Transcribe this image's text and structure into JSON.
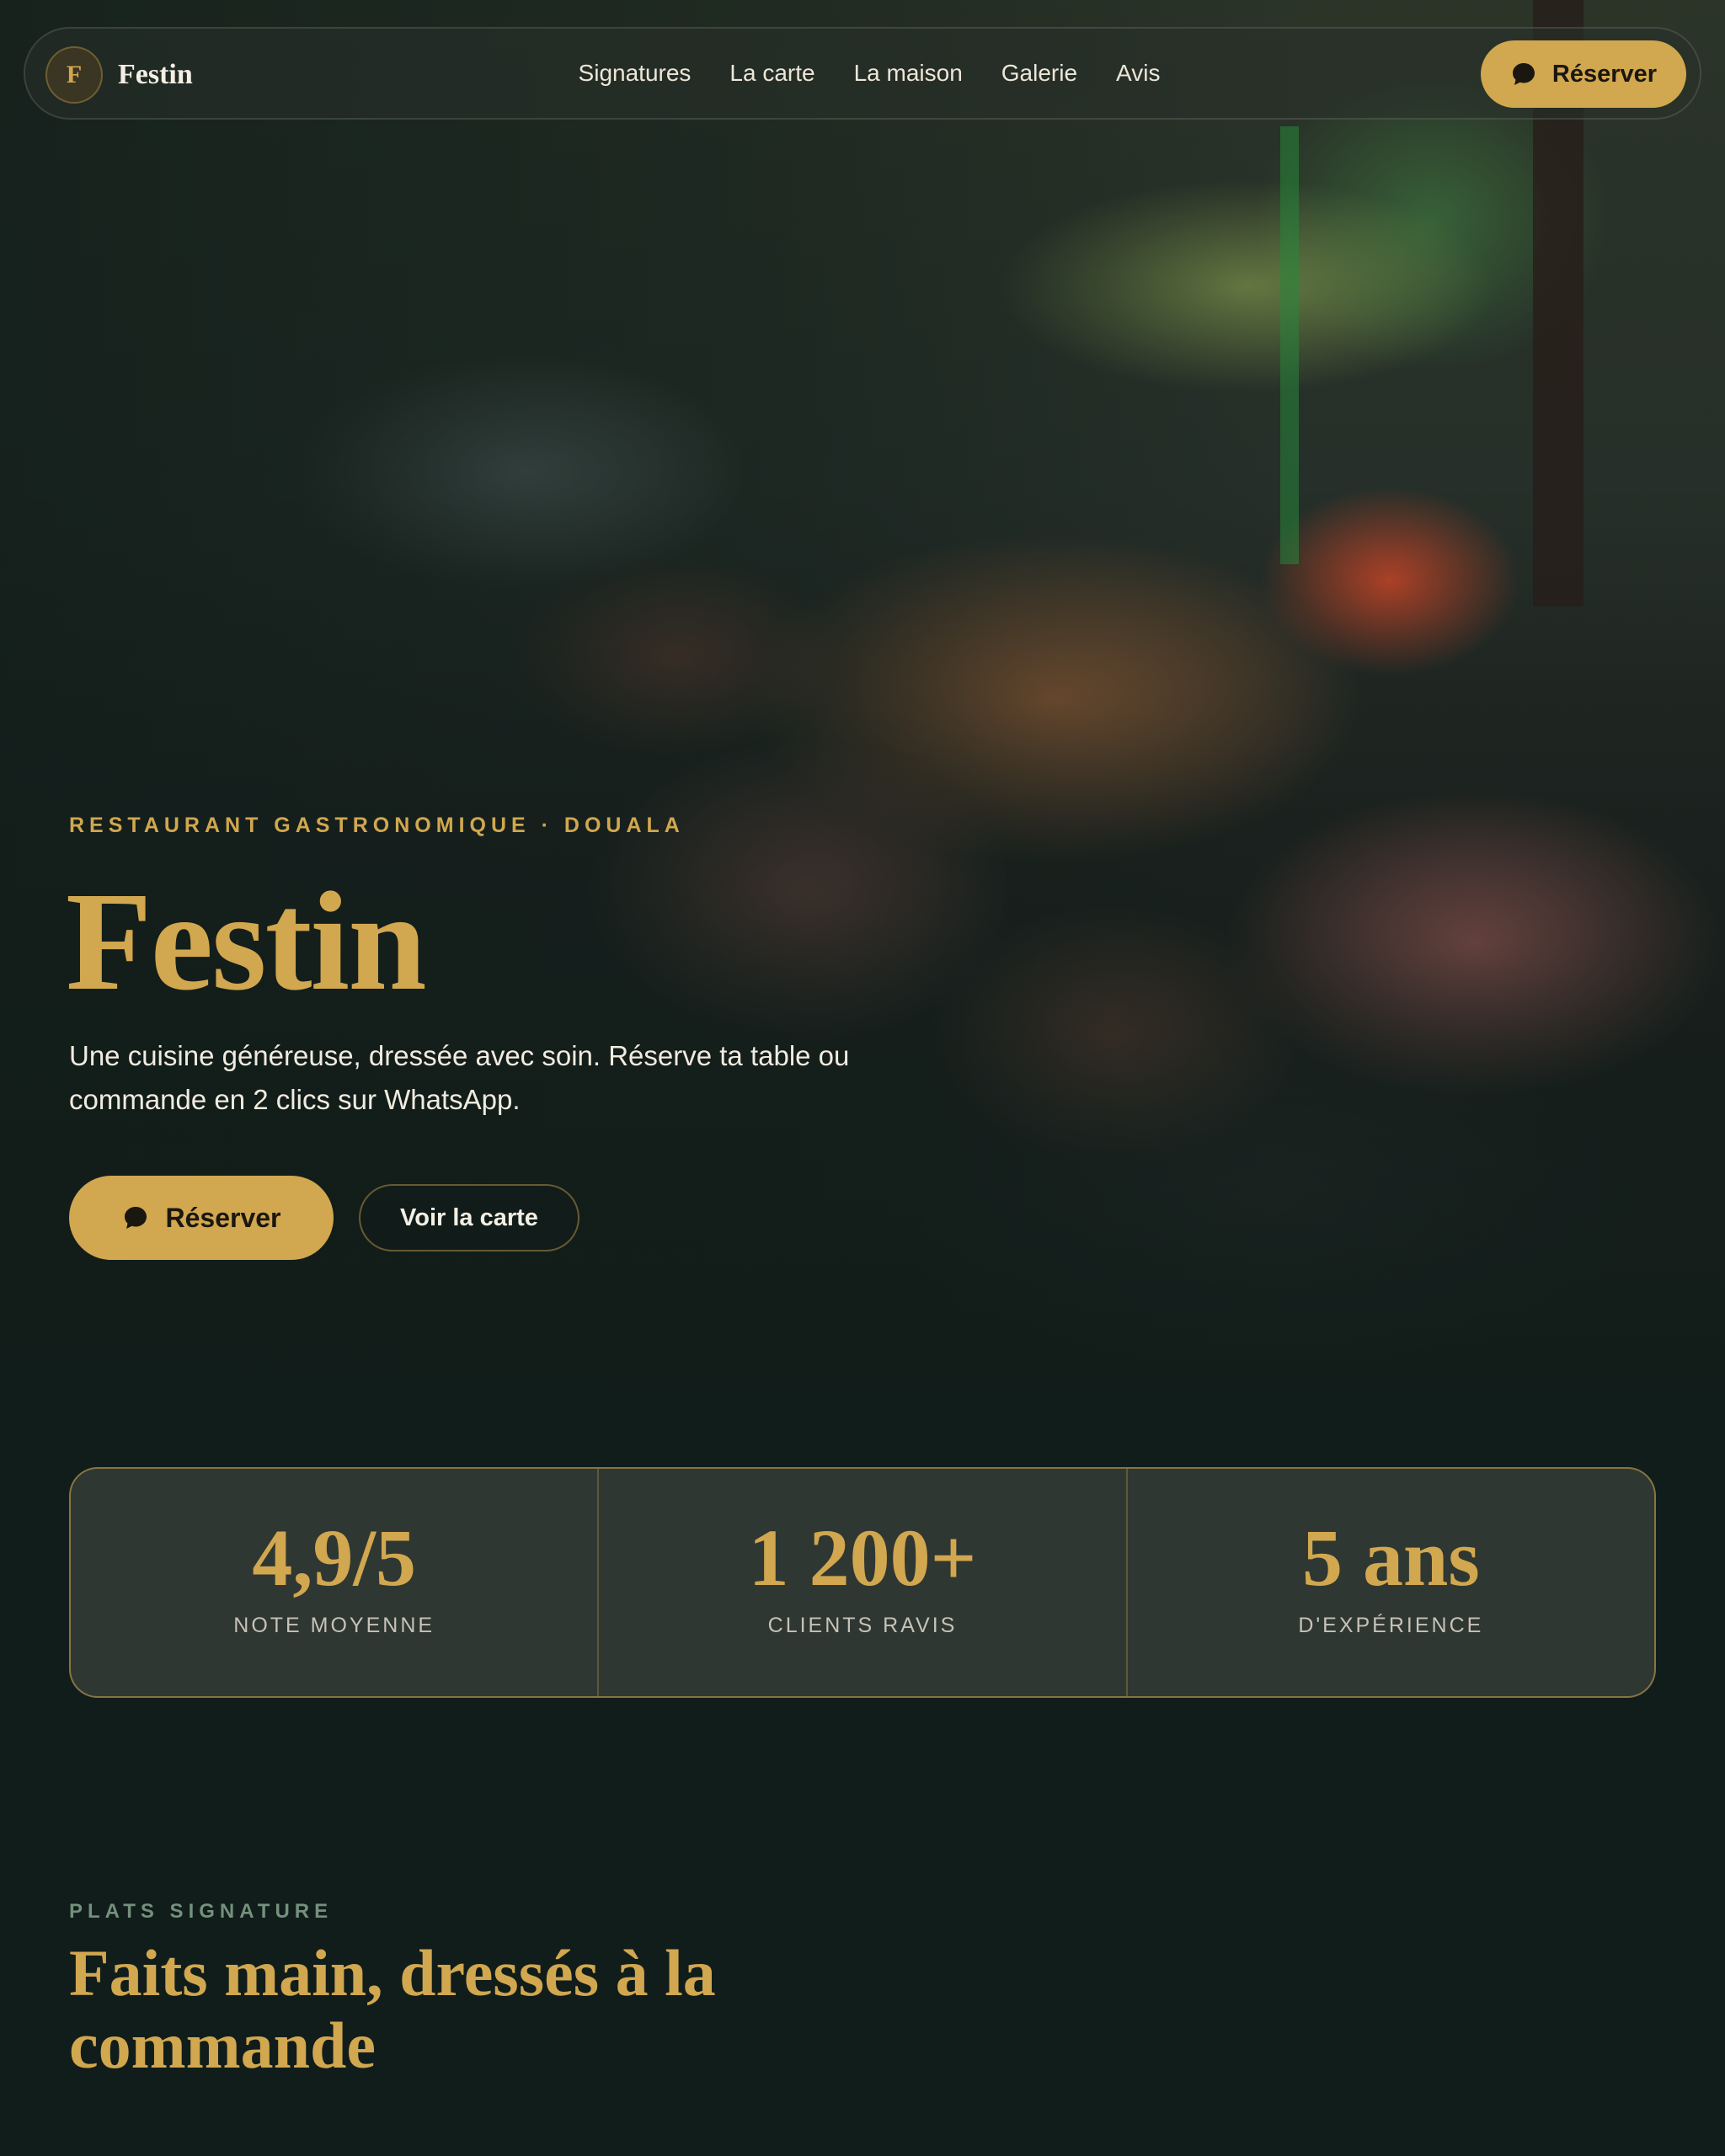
{
  "nav": {
    "brand_initial": "F",
    "brand_name": "Festin",
    "links": [
      "Signatures",
      "La carte",
      "La maison",
      "Galerie",
      "Avis"
    ],
    "cta_label": "Réserver",
    "cta_icon": "chat-bubble-icon"
  },
  "hero": {
    "eyebrow": "RESTAURANT GASTRONOMIQUE · DOUALA",
    "title": "Festin",
    "subtitle": "Une cuisine généreuse, dressée avec soin. Réserve ta table ou commande en 2 clics sur WhatsApp.",
    "primary_label": "Réserver",
    "secondary_label": "Voir la carte",
    "image": "grilled-meat-platter-photo"
  },
  "stats": [
    {
      "value": "4,9/5",
      "label": "NOTE MOYENNE"
    },
    {
      "value": "1 200+",
      "label": "CLIENTS RAVIS"
    },
    {
      "value": "5 ans",
      "label": "D'EXPÉRIENCE"
    }
  ],
  "signature": {
    "eyebrow": "PLATS SIGNATURE",
    "title": "Faits main, dressés à la commande"
  },
  "colors": {
    "accent": "#d1a74f",
    "background": "#111d1a",
    "card": "#2f3733",
    "muted_green": "#74907e"
  }
}
